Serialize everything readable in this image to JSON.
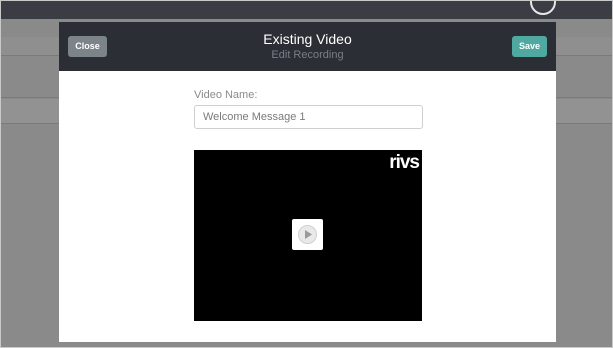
{
  "modal": {
    "close_label": "Close",
    "save_label": "Save",
    "title": "Existing Video",
    "subtitle": "Edit Recording"
  },
  "form": {
    "video_name_label": "Video Name:",
    "video_name_value": "Welcome Message 1"
  },
  "video": {
    "logo_text": "rivs",
    "play_icon": "play-icon"
  },
  "colors": {
    "header_bg": "#2b2e35",
    "close_button": "#7c8489",
    "save_button": "#4fa9a0",
    "overlay": "#8a8a8a"
  }
}
